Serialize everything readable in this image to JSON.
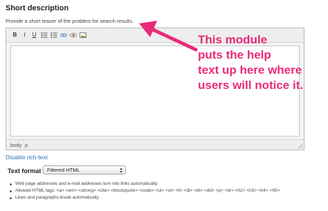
{
  "section": {
    "title": "Short description",
    "help_text": "Provide a short teaser of the problem for search results."
  },
  "editor": {
    "toolbar": [
      {
        "label": "B",
        "icon": "bold-icon"
      },
      {
        "label": "I",
        "icon": "italic-icon"
      },
      {
        "label": "U",
        "icon": "underline-icon"
      },
      {
        "label": "",
        "icon": "bulleted-list-icon"
      },
      {
        "label": "",
        "icon": "numbered-list-icon"
      },
      {
        "label": "",
        "icon": "link-icon"
      },
      {
        "label": "",
        "icon": "unlink-icon"
      },
      {
        "label": "",
        "icon": "image-icon"
      }
    ],
    "content": "",
    "path": [
      "body",
      "p"
    ]
  },
  "disable_rich_text": "Disable rich-text",
  "text_format": {
    "label": "Text format",
    "selected": "Filtered HTML"
  },
  "tips": [
    "Web page addresses and e-mail addresses turn into links automatically.",
    "Allowed HTML tags: <a> <em> <strong> <cite> <blockquote> <code> <ul> <ol> <li> <dl> <dt> <dd> <p> <br> <h2> <h3> <h4> <h5>",
    "Lines and paragraphs break automatically."
  ],
  "annotation": {
    "lines": [
      "This module",
      "puts the help",
      "text up here where",
      "users will notice it."
    ],
    "color": "#ea2a78"
  }
}
